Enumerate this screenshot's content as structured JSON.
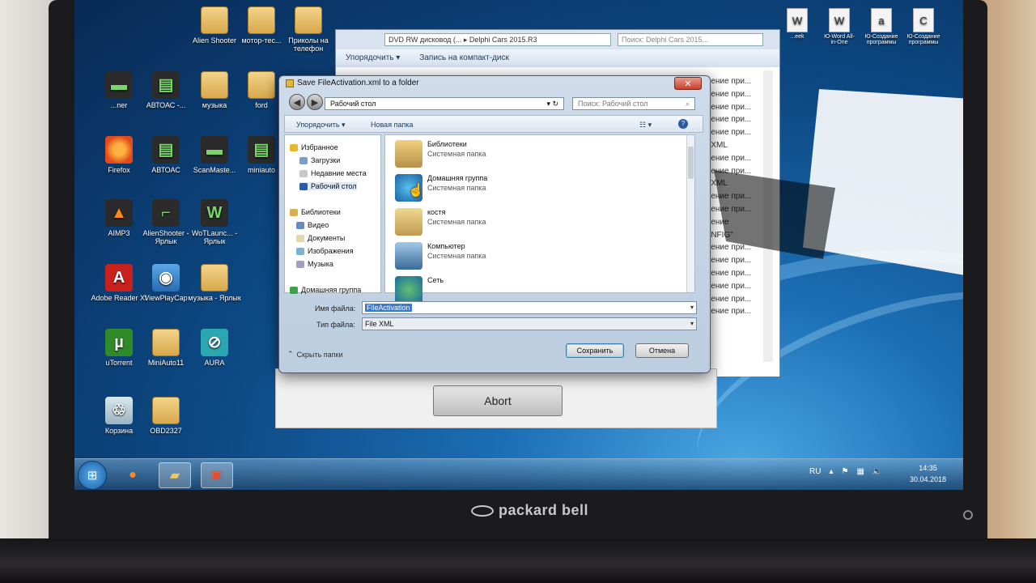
{
  "desktop_icons": [
    {
      "label": "Alien Shooter",
      "icon": "folder-icon"
    },
    {
      "label": "мотор-тес...",
      "icon": "folder-icon"
    },
    {
      "label": "Приколы на телефон",
      "icon": "folder-icon"
    },
    {
      "label": "...ner",
      "icon": "scanner-icon"
    },
    {
      "label": "АВТОАС -...",
      "icon": "device-icon"
    },
    {
      "label": "музыка",
      "icon": "folder-icon"
    },
    {
      "label": "ford",
      "icon": "folder-icon"
    },
    {
      "label": "Firefox",
      "icon": "firefox-icon"
    },
    {
      "label": "АВТОАС",
      "icon": "device-icon"
    },
    {
      "label": "ScanMaste...",
      "icon": "scanner-icon"
    },
    {
      "label": "miniauto",
      "icon": "device-icon"
    },
    {
      "label": "AIMP3",
      "icon": "aimp-icon"
    },
    {
      "label": "AlienShooter - Ярлык",
      "icon": "gun-icon"
    },
    {
      "label": "WoTLaunc... - Ярлык",
      "icon": "wot-icon"
    },
    {
      "label": "Adobe Reader XI",
      "icon": "adobe-icon"
    },
    {
      "label": "ViewPlayCap",
      "icon": "camera-icon"
    },
    {
      "label": "музыка - Ярлык",
      "icon": "folder-icon"
    },
    {
      "label": "uTorrent",
      "icon": "utorrent-icon"
    },
    {
      "label": "MiniAuto11",
      "icon": "folder-icon"
    },
    {
      "label": "AURA",
      "icon": "aura-icon"
    },
    {
      "label": "Корзина",
      "icon": "recycle-bin-icon"
    },
    {
      "label": "OBD2327",
      "icon": "folder-icon"
    }
  ],
  "explorer": {
    "address": "DVD RW дисковод (...  ▸  Delphi Cars 2015.R3",
    "search": "Поиск: Delphi Cars 2015...",
    "toolbar": [
      "Упорядочить ▾",
      "Запись на компакт-диск"
    ],
    "type_column": [
      "...ение при...",
      "...ение при...",
      "...ение при...",
      "...ение при...",
      "...ение при...",
      "...XML",
      "...ение при...",
      "...ение при...",
      "...XML",
      "...ение при...",
      "...ение при...",
      "...ение",
      "...NFIG\"",
      "...ение при...",
      "...ение при...",
      "...ение при...",
      "...ение при...",
      "...ение при...",
      "...ение при..."
    ]
  },
  "progress_window": {
    "abort_label": "Abort"
  },
  "dialog": {
    "title": "Save FileActivation.xml to a folder",
    "close": "✕",
    "address": "Рабочий стол",
    "address_arrow": "▸",
    "search_placeholder": "Поиск: Рабочий стол",
    "toolbar": {
      "organize": "Упорядочить ▾",
      "new_folder": "Новая папка"
    },
    "nav": {
      "favorites": "Избранное",
      "downloads": "Загрузки",
      "recent": "Недавние места",
      "desktop": "Рабочий стол",
      "libraries": "Библиотеки",
      "video": "Видео",
      "documents": "Документы",
      "images": "Изображения",
      "music": "Музыка",
      "homegroup": "Домашняя группа"
    },
    "files": [
      {
        "name": "Библиотеки",
        "type": "Системная папка",
        "icon": "libraries-icon"
      },
      {
        "name": "Домашняя группа",
        "type": "Системная папка",
        "icon": "homegroup-icon"
      },
      {
        "name": "костя",
        "type": "Системная папка",
        "icon": "user-folder-icon"
      },
      {
        "name": "Компьютер",
        "type": "Системная папка",
        "icon": "computer-icon"
      },
      {
        "name": "Сеть",
        "type": "",
        "icon": "network-icon"
      }
    ],
    "filename_label": "Имя файла:",
    "filename_value": "FileActivation",
    "filetype_label": "Тип файла:",
    "filetype_value": "File XML",
    "hide_folders": "Скрыть папки",
    "save": "Сохранить",
    "cancel": "Отмена"
  },
  "taskbar": {
    "language": "RU",
    "time": "14:35",
    "date": "30.04.2018"
  },
  "top_right_icons": [
    {
      "label": "...eek",
      "glyph": "W"
    },
    {
      "label": "Ю-Word All-in-One",
      "glyph": "W"
    },
    {
      "label": "Ю-Создание программы",
      "glyph": "a"
    },
    {
      "label": "Ю-Создание программы",
      "glyph": "C"
    }
  ],
  "laptop_brand": "packard bell"
}
